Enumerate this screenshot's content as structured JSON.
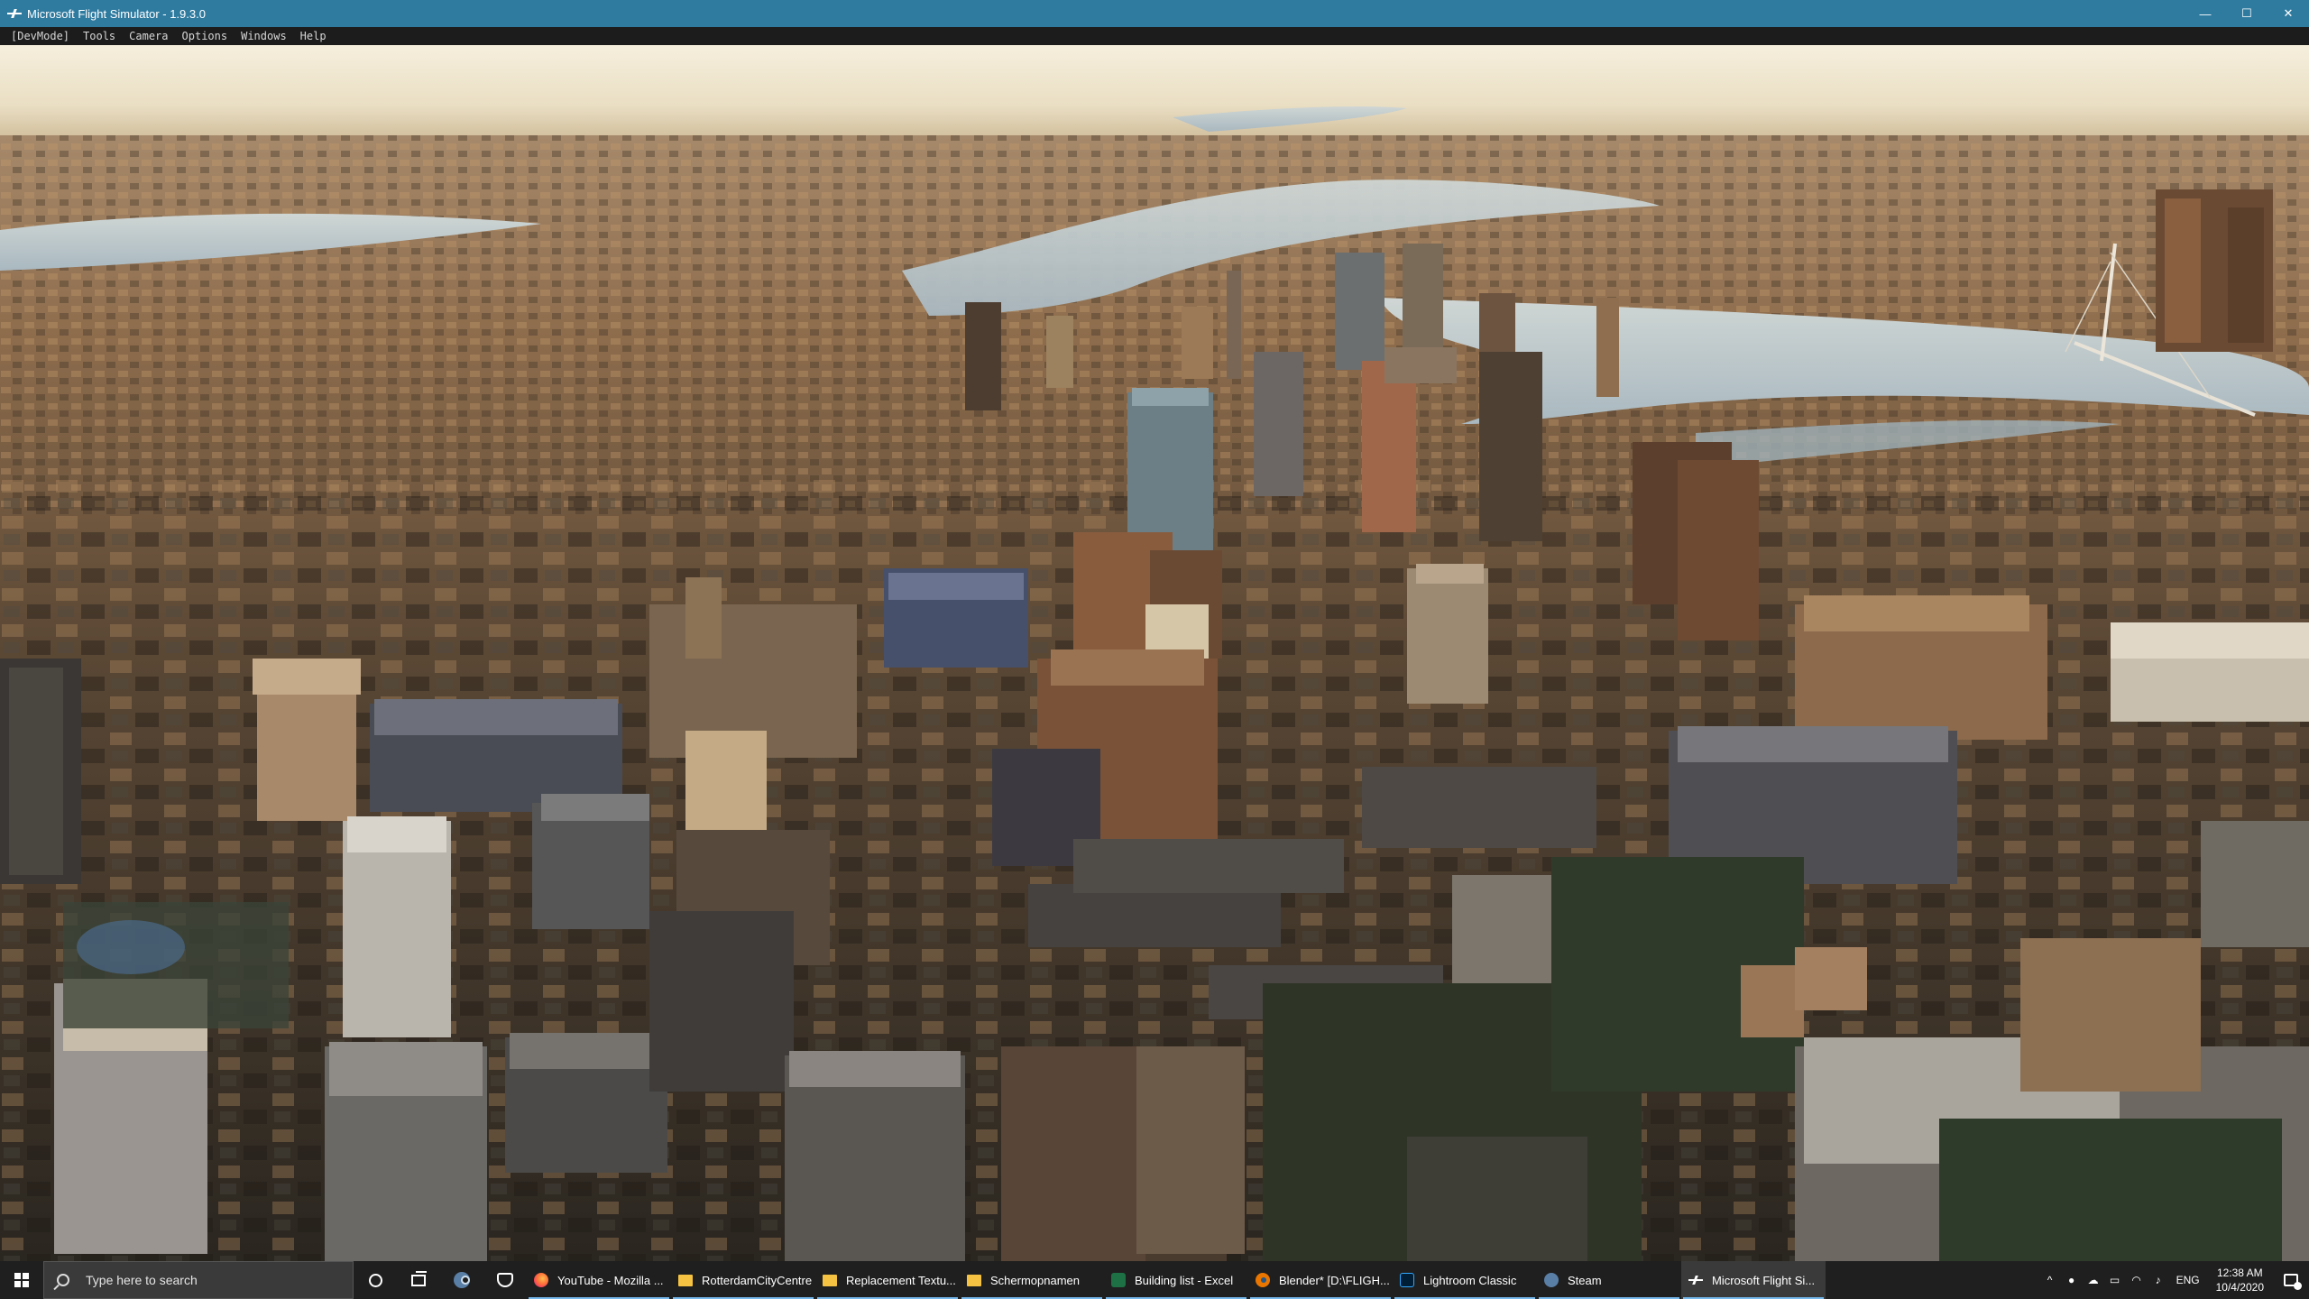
{
  "window": {
    "title": "Microsoft Flight Simulator - 1.9.3.0",
    "controls": {
      "minimize": "—",
      "maximize": "☐",
      "close": "✕"
    }
  },
  "menu": [
    "[DevMode]",
    "Tools",
    "Camera",
    "Options",
    "Windows",
    "Help"
  ],
  "scene": {
    "icon": "aerial-city-view",
    "colors": {
      "sky_top": "#f4ecd8",
      "sky_horizon": "#d9c9a4",
      "water": "#b8c6cc",
      "city_warm": "#8a6a4a",
      "city_shadow": "#2e2a22"
    }
  },
  "taskbar": {
    "search_placeholder": "Type here to search",
    "apps": [
      {
        "label": "YouTube - Mozilla ...",
        "icon": "firefox-icon"
      },
      {
        "label": "RotterdamCityCentre",
        "icon": "folder-icon"
      },
      {
        "label": "Replacement Textu...",
        "icon": "folder-icon"
      },
      {
        "label": "Schermopnamen",
        "icon": "folder-icon"
      },
      {
        "label": "Building list - Excel",
        "icon": "excel-icon"
      },
      {
        "label": "Blender* [D:\\FLIGH...",
        "icon": "blender-icon"
      },
      {
        "label": "Lightroom Classic",
        "icon": "lightroom-icon"
      },
      {
        "label": "Steam",
        "icon": "steam-icon"
      },
      {
        "label": "Microsoft Flight Si...",
        "icon": "flight-simulator-icon"
      }
    ],
    "tray": {
      "language": "ENG",
      "time": "12:38 AM",
      "date": "10/4/2020",
      "chevron": "^"
    }
  }
}
